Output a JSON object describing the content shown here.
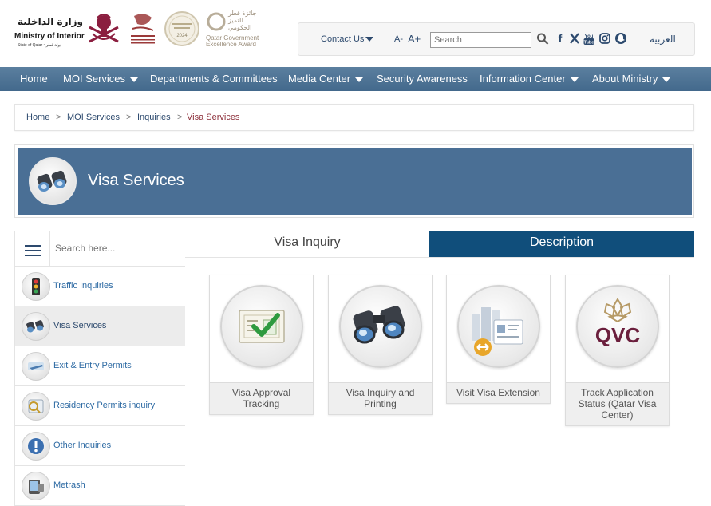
{
  "header": {
    "moi_arabic": "وزارة الداخلية",
    "moi_english": "Ministry of Interior",
    "moi_state": "State of Qatar • دولة قطر",
    "award_arabic": "جائزة قطر للتميز الحكومي",
    "award_english": "Qatar Government Excellence Award",
    "award_year": "2024"
  },
  "utility": {
    "contact_label": "Contact Us",
    "font_decrease": "A-",
    "font_increase": "A+",
    "search_placeholder": "Search",
    "arabic_label": "العربية",
    "social_icons": [
      "facebook-icon",
      "x-icon",
      "youtube-icon",
      "instagram-icon",
      "snapchat-icon"
    ]
  },
  "nav": {
    "items": [
      {
        "label": "Home"
      },
      {
        "label": "MOI Services"
      },
      {
        "label": "Departments & Committees"
      },
      {
        "label": "Media Center"
      },
      {
        "label": "Security Awareness"
      },
      {
        "label": "Information Center"
      },
      {
        "label": "About Ministry"
      }
    ]
  },
  "breadcrumb": {
    "items": [
      "Home",
      "MOI Services",
      "Inquiries",
      "Visa Services"
    ],
    "separator": ">"
  },
  "page": {
    "title": "Visa Services"
  },
  "sidebar": {
    "search_placeholder": "Search here...",
    "items": [
      {
        "label": "Traffic Inquiries",
        "icon": "traffic-light-icon"
      },
      {
        "label": "Visa Services",
        "icon": "binoculars-icon"
      },
      {
        "label": "Exit & Entry Permits",
        "icon": "airplane-icon"
      },
      {
        "label": "Residency Permits inquiry",
        "icon": "residency-icon"
      },
      {
        "label": "Other Inquiries",
        "icon": "exclamation-icon"
      },
      {
        "label": "Metrash",
        "icon": "metrash-icon"
      }
    ]
  },
  "tabs": {
    "inquiry": "Visa Inquiry",
    "description": "Description"
  },
  "services": [
    {
      "label": "Visa Approval Tracking",
      "icon": "approval-document-icon"
    },
    {
      "label": "Visa Inquiry and Printing",
      "icon": "binoculars-icon"
    },
    {
      "label": "Visit Visa Extension",
      "icon": "visa-extension-icon"
    },
    {
      "label": "Track Application Status (Qatar Visa Center)",
      "icon": "qvc-logo"
    }
  ],
  "qvc_logo_text": "QVC",
  "colors": {
    "nav_bg": "#4d7396",
    "banner_bg": "#4a6f95",
    "tab_active_bg": "#104e7b",
    "link": "#2d6aa3",
    "breadcrumb_current": "#8b2c37"
  }
}
